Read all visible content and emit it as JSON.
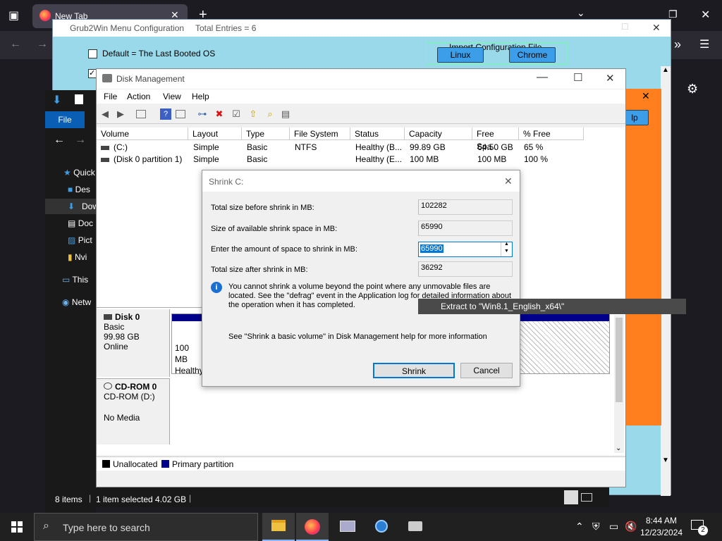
{
  "browser": {
    "tab_title": "New Tab"
  },
  "grub": {
    "title": "Grub2Win Menu Configuration",
    "total_entries": "Total Entries = 6",
    "default_option": "Default = The Last Booted OS",
    "import_label": "Import Configuration File",
    "linux_button": "Linux",
    "chrome_button": "Chrome",
    "help_fragment": "lp"
  },
  "explorer": {
    "file_tab": "File",
    "nav_items": [
      "Quick",
      "Des",
      "Dow",
      "Doc",
      "Pict",
      "Nvi",
      "This",
      "Netw"
    ],
    "status_items": "8 items",
    "status_selected": "1 item selected  4.02 GB"
  },
  "disk_mgmt": {
    "title": "Disk Management",
    "menu": [
      "File",
      "Action",
      "View",
      "Help"
    ],
    "columns": [
      "Volume",
      "Layout",
      "Type",
      "File System",
      "Status",
      "Capacity",
      "Free Spa...",
      "% Free"
    ],
    "rows": [
      [
        "(C:)",
        "Simple",
        "Basic",
        "NTFS",
        "Healthy (B...",
        "99.89 GB",
        "64.50 GB",
        "65 %"
      ],
      [
        "(Disk 0 partition 1)",
        "Simple",
        "Basic",
        "",
        "Healthy (E...",
        "100 MB",
        "100 MB",
        "100 %"
      ]
    ],
    "disk0": {
      "name": "Disk 0",
      "type": "Basic",
      "size": "99.98 GB",
      "state": "Online"
    },
    "cdrom": {
      "name": "CD-ROM 0",
      "sub": "CD-ROM (D:)",
      "state": "No Media"
    },
    "partition_small": {
      "size": "100 MB",
      "status": "Healthy"
    },
    "legend_unallocated": "Unallocated",
    "legend_primary": "Primary partition"
  },
  "shrink": {
    "title": "Shrink C:",
    "label_total_before": "Total size before shrink in MB:",
    "value_total_before": "102282",
    "label_available": "Size of available shrink space in MB:",
    "value_available": "65990",
    "label_enter": "Enter the amount of space to shrink in MB:",
    "value_enter": "65990",
    "label_after": "Total size after shrink in MB:",
    "value_after": "36292",
    "info_text": "You cannot shrink a volume beyond the point where any unmovable files are located. See the \"defrag\" event in the Application log for detailed information about the operation when it has completed.",
    "help_text": "See \"Shrink a basic volume\" in Disk Management help for more information",
    "shrink_button": "Shrink",
    "cancel_button": "Cancel"
  },
  "extract_tooltip": "Extract to \"Win8.1_English_x64\\\"",
  "taskbar": {
    "search_placeholder": "Type here to search",
    "time": "8:44 AM",
    "date": "12/23/2024",
    "notification_count": "2"
  },
  "colors": {
    "grub_bg": "#99d9ea",
    "grub_button": "#3c9ee8",
    "orange_panel": "#ff7f1e",
    "primary_partition": "#00008b",
    "selection": "#0078d7"
  }
}
